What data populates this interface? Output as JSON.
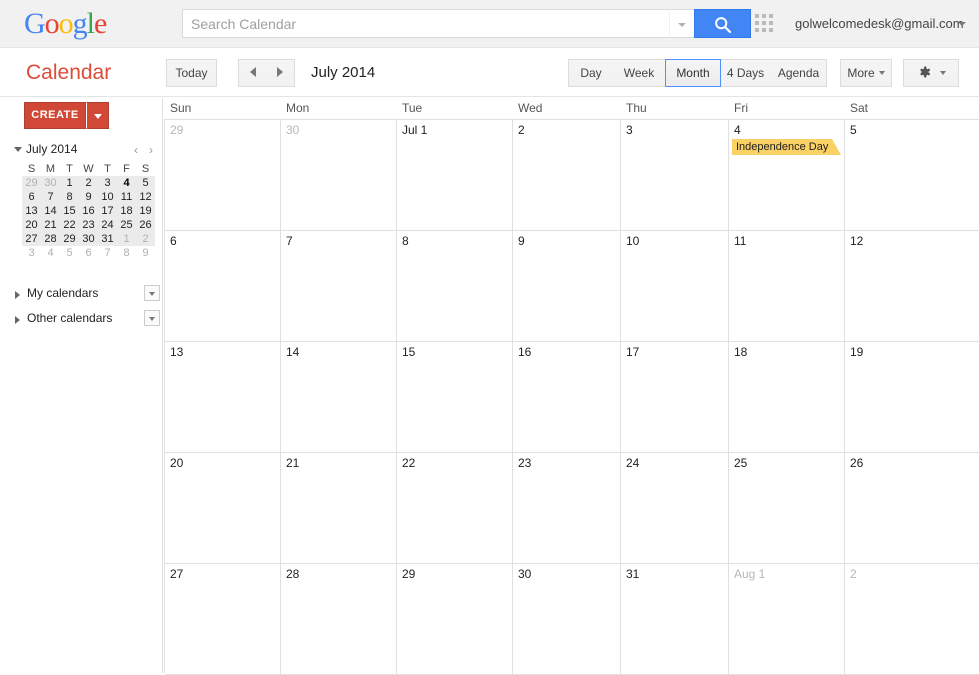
{
  "topbar": {
    "logo_text": "Google",
    "logo_letters": [
      "G",
      "o",
      "o",
      "g",
      "l",
      "e"
    ],
    "search": {
      "placeholder": "Search Calendar",
      "value": "",
      "search_icon": "search-icon",
      "dropdown_icon": "chevron-down-icon"
    },
    "apps_grid_icon": "apps-grid-icon",
    "account_email": "golwelcomedesk@gmail.com",
    "account_caret_icon": "chevron-down-icon"
  },
  "subbar": {
    "app_title": "Calendar",
    "today_label": "Today",
    "prev_label": "Previous period",
    "next_label": "Next period",
    "period_label": "July 2014",
    "views": [
      {
        "label": "Day",
        "active": false
      },
      {
        "label": "Week",
        "active": false
      },
      {
        "label": "Month",
        "active": true
      },
      {
        "label": "4 Days",
        "active": false
      },
      {
        "label": "Agenda",
        "active": false
      }
    ],
    "more_label": "More",
    "gear_icon": "gear-icon"
  },
  "sidebar": {
    "create_label": "CREATE",
    "create_arrow_icon": "caret-down-icon",
    "mini_calendar": {
      "collapse_icon": "caret-down-icon",
      "month_label": "July 2014",
      "prev_label": "‹",
      "next_label": "›",
      "dow": [
        "S",
        "M",
        "T",
        "W",
        "T",
        "F",
        "S"
      ],
      "weeks": [
        {
          "in_month": true,
          "days": [
            {
              "n": "29",
              "other": true
            },
            {
              "n": "30",
              "other": true
            },
            {
              "n": "1"
            },
            {
              "n": "2"
            },
            {
              "n": "3"
            },
            {
              "n": "4",
              "today": true
            },
            {
              "n": "5"
            }
          ]
        },
        {
          "in_month": true,
          "days": [
            {
              "n": "6"
            },
            {
              "n": "7"
            },
            {
              "n": "8"
            },
            {
              "n": "9"
            },
            {
              "n": "10"
            },
            {
              "n": "11"
            },
            {
              "n": "12"
            }
          ]
        },
        {
          "in_month": true,
          "days": [
            {
              "n": "13"
            },
            {
              "n": "14"
            },
            {
              "n": "15"
            },
            {
              "n": "16"
            },
            {
              "n": "17"
            },
            {
              "n": "18"
            },
            {
              "n": "19"
            }
          ]
        },
        {
          "in_month": true,
          "days": [
            {
              "n": "20"
            },
            {
              "n": "21"
            },
            {
              "n": "22"
            },
            {
              "n": "23"
            },
            {
              "n": "24"
            },
            {
              "n": "25"
            },
            {
              "n": "26"
            }
          ]
        },
        {
          "in_month": true,
          "days": [
            {
              "n": "27"
            },
            {
              "n": "28"
            },
            {
              "n": "29"
            },
            {
              "n": "30"
            },
            {
              "n": "31"
            },
            {
              "n": "1",
              "other": true
            },
            {
              "n": "2",
              "other": true
            }
          ]
        },
        {
          "in_month": false,
          "days": [
            {
              "n": "3",
              "other": true
            },
            {
              "n": "4",
              "other": true
            },
            {
              "n": "5",
              "other": true
            },
            {
              "n": "6",
              "other": true
            },
            {
              "n": "7",
              "other": true
            },
            {
              "n": "8",
              "other": true
            },
            {
              "n": "9",
              "other": true
            }
          ]
        }
      ]
    },
    "sections": [
      {
        "label": "My calendars",
        "expanded": false,
        "dropdown_icon": "caret-down-icon"
      },
      {
        "label": "Other calendars",
        "expanded": false,
        "dropdown_icon": "caret-down-icon"
      }
    ]
  },
  "calendar": {
    "day_headers": [
      "Sun",
      "Mon",
      "Tue",
      "Wed",
      "Thu",
      "Fri",
      "Sat"
    ],
    "weeks": [
      {
        "days": [
          {
            "label": "29",
            "other": true
          },
          {
            "label": "30",
            "other": true
          },
          {
            "label": "Jul 1"
          },
          {
            "label": "2"
          },
          {
            "label": "3"
          },
          {
            "label": "4",
            "events": [
              {
                "title": "Independence Day",
                "color": "#fad165"
              }
            ]
          },
          {
            "label": "5"
          }
        ]
      },
      {
        "days": [
          {
            "label": "6"
          },
          {
            "label": "7"
          },
          {
            "label": "8"
          },
          {
            "label": "9"
          },
          {
            "label": "10"
          },
          {
            "label": "11"
          },
          {
            "label": "12"
          }
        ]
      },
      {
        "days": [
          {
            "label": "13"
          },
          {
            "label": "14"
          },
          {
            "label": "15"
          },
          {
            "label": "16"
          },
          {
            "label": "17"
          },
          {
            "label": "18"
          },
          {
            "label": "19"
          }
        ]
      },
      {
        "days": [
          {
            "label": "20"
          },
          {
            "label": "21"
          },
          {
            "label": "22"
          },
          {
            "label": "23"
          },
          {
            "label": "24"
          },
          {
            "label": "25"
          },
          {
            "label": "26"
          }
        ]
      },
      {
        "days": [
          {
            "label": "27"
          },
          {
            "label": "28"
          },
          {
            "label": "29"
          },
          {
            "label": "30"
          },
          {
            "label": "31"
          },
          {
            "label": "Aug 1",
            "other": true
          },
          {
            "label": "2",
            "other": true
          }
        ]
      }
    ]
  },
  "colors": {
    "brand_red": "#dd4b39",
    "create_red": "#d14836",
    "search_blue": "#4285f4",
    "active_border_blue": "#4d90fe",
    "event_amber": "#fad165",
    "grid_line": "#e0e0e0"
  }
}
